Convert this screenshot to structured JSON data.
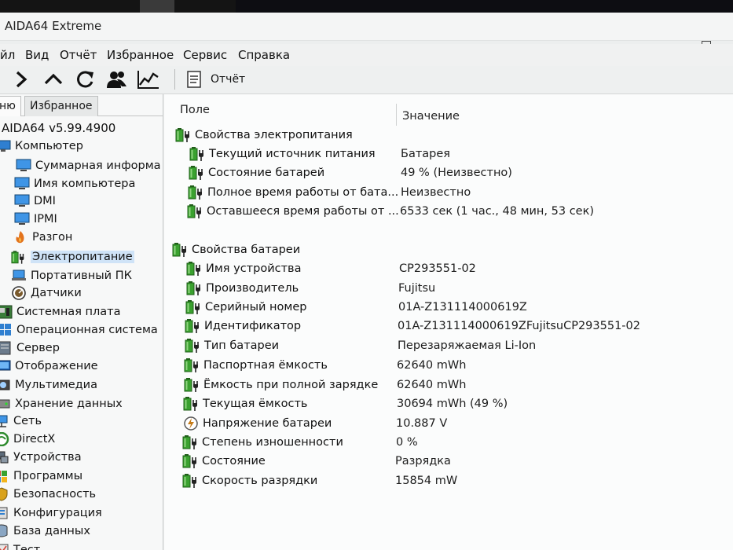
{
  "window": {
    "title": "AIDA64 Extreme"
  },
  "menu": [
    "йл",
    "Вид",
    "Отчёт",
    "Избранное",
    "Сервис",
    "Справка"
  ],
  "toolbar": {
    "icons": [
      "forward-icon",
      "up-icon",
      "refresh-icon",
      "user-icon",
      "chart-icon"
    ],
    "report_label": "Отчёт"
  },
  "sidebar": {
    "tabs": [
      "ню",
      "Избранное"
    ],
    "version": "AIDA64 v5.99.4900",
    "items": [
      {
        "label": "Компьютер",
        "icon": "computer-icon"
      },
      {
        "label": "Суммарная информа",
        "icon": "monitor-icon"
      },
      {
        "label": "Имя компьютера",
        "icon": "monitor-icon"
      },
      {
        "label": "DMI",
        "icon": "monitor-icon"
      },
      {
        "label": "IPMI",
        "icon": "monitor-icon"
      },
      {
        "label": "Разгон",
        "icon": "flame-icon"
      },
      {
        "label": "Электропитание",
        "icon": "battery-plug-icon"
      },
      {
        "label": "Портативный ПК",
        "icon": "laptop-icon"
      },
      {
        "label": "Датчики",
        "icon": "gauge-icon"
      },
      {
        "label": "Системная плата",
        "icon": "motherboard-icon"
      },
      {
        "label": "Операционная система",
        "icon": "windows-icon"
      },
      {
        "label": "Сервер",
        "icon": "server-icon"
      },
      {
        "label": "Отображение",
        "icon": "display-icon"
      },
      {
        "label": "Мультимедиа",
        "icon": "multimedia-icon"
      },
      {
        "label": "Хранение данных",
        "icon": "storage-icon"
      },
      {
        "label": "Сеть",
        "icon": "network-icon"
      },
      {
        "label": "DirectX",
        "icon": "directx-icon"
      },
      {
        "label": "Устройства",
        "icon": "devices-icon"
      },
      {
        "label": "Программы",
        "icon": "programs-icon"
      },
      {
        "label": "Безопасность",
        "icon": "security-icon"
      },
      {
        "label": "Конфигурация",
        "icon": "config-icon"
      },
      {
        "label": "База данных",
        "icon": "database-icon"
      },
      {
        "label": "Тест",
        "icon": "test-icon"
      }
    ]
  },
  "columns": {
    "field": "Поле",
    "value": "Значение"
  },
  "groups": [
    {
      "title": "Свойства электропитания",
      "rows": [
        {
          "field": "Текущий источник питания",
          "value": "Батарея",
          "icon": "battery-plug-icon"
        },
        {
          "field": "Состояние батарей",
          "value": "49 % (Неизвестно)",
          "icon": "battery-plug-icon"
        },
        {
          "field": "Полное время работы от бата...",
          "value": "Неизвестно",
          "icon": "battery-plug-icon"
        },
        {
          "field": "Оставшееся время работы от ...",
          "value": "6533 сек (1 час., 48 мин, 53 сек)",
          "icon": "battery-plug-icon"
        }
      ]
    },
    {
      "title": "Свойства батареи",
      "rows": [
        {
          "field": "Имя устройства",
          "value": "CP293551-02",
          "icon": "battery-plug-icon"
        },
        {
          "field": "Производитель",
          "value": "Fujitsu",
          "icon": "battery-plug-icon"
        },
        {
          "field": "Серийный номер",
          "value": "01A-Z131114000619Z",
          "icon": "battery-plug-icon"
        },
        {
          "field": "Идентификатор",
          "value": "01A-Z131114000619ZFujitsuCP293551-02",
          "icon": "battery-plug-icon"
        },
        {
          "field": "Тип батареи",
          "value": "Перезаряжаемая Li-Ion",
          "icon": "battery-plug-icon"
        },
        {
          "field": "Паспортная ёмкость",
          "value": "62640 mWh",
          "icon": "battery-plug-icon"
        },
        {
          "field": "Ёмкость при полной зарядке",
          "value": "62640 mWh",
          "icon": "battery-plug-icon"
        },
        {
          "field": "Текущая ёмкость",
          "value": "30694 mWh  (49 %)",
          "icon": "battery-plug-icon"
        },
        {
          "field": "Напряжение батареи",
          "value": "10.887 V",
          "icon": "voltage-icon"
        },
        {
          "field": "Степень изношенности",
          "value": "0 %",
          "icon": "battery-plug-icon"
        },
        {
          "field": "Состояние",
          "value": "Разрядка",
          "icon": "battery-plug-icon"
        },
        {
          "field": "Скорость разрядки",
          "value": "15854 mW",
          "icon": "battery-plug-icon"
        }
      ]
    }
  ],
  "colors": {
    "battery_green": "#3aa12f",
    "selection": "#cfe3f7",
    "monitor_blue": "#2f7fd0"
  }
}
